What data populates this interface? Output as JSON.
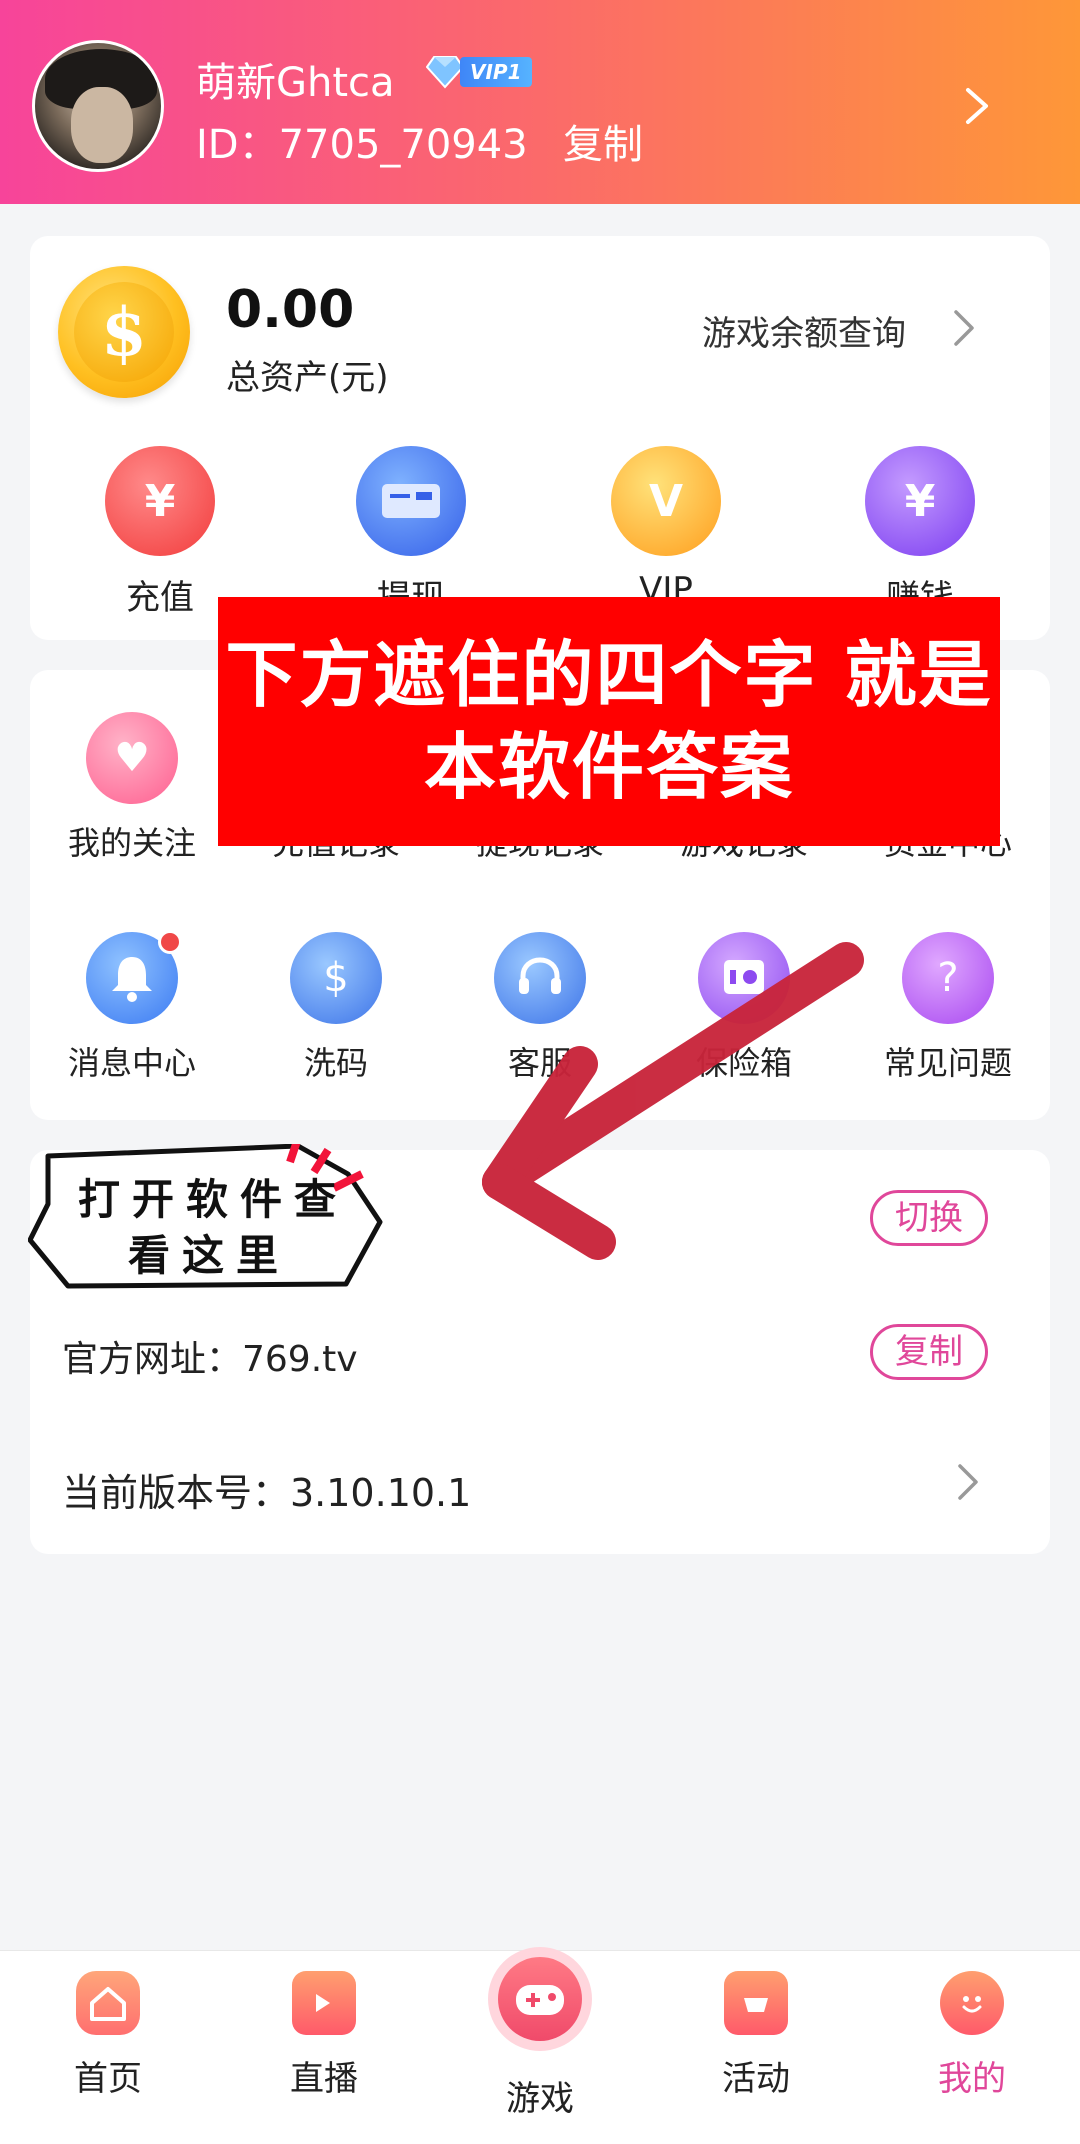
{
  "header": {
    "username": "萌新Ghtca",
    "vip_label": "VIP1",
    "user_id": "ID：7705_70943",
    "copy_label": "复制"
  },
  "assets": {
    "balance": "0.00",
    "balance_label": "总资产(元)",
    "game_balance_label": "游戏余额查询",
    "quick_actions": [
      {
        "label": "充值",
        "icon": "money-bag-icon"
      },
      {
        "label": "提现",
        "icon": "card-icon"
      },
      {
        "label": "VIP",
        "icon": "vip-diamond-icon"
      },
      {
        "label": "赚钱",
        "icon": "earn-bag-icon"
      }
    ]
  },
  "menu": {
    "row1": [
      {
        "label": "我的关注",
        "icon": "heart-plus-icon"
      },
      {
        "label": "充值记录",
        "icon": "record-icon"
      },
      {
        "label": "提现记录",
        "icon": "withdraw-record-icon"
      },
      {
        "label": "游戏记录",
        "icon": "game-record-icon"
      },
      {
        "label": "资金中心",
        "icon": "fund-center-icon"
      }
    ],
    "row2": [
      {
        "label": "消息中心",
        "icon": "bell-icon"
      },
      {
        "label": "洗码",
        "icon": "chip-icon"
      },
      {
        "label": "客服",
        "icon": "headset-icon"
      },
      {
        "label": "保险箱",
        "icon": "safe-icon"
      },
      {
        "label": "常见问题",
        "icon": "question-icon"
      }
    ]
  },
  "overlay": {
    "line1": "下方遮住的四个字 就是",
    "line2": "本软件答案"
  },
  "sticker": {
    "line1": "打开软件查",
    "line2": "看这里"
  },
  "info": {
    "switch_label": "切换",
    "official_url": "官方网址：769.tv",
    "copy_label": "复制",
    "version": "当前版本号：3.10.10.1"
  },
  "nav": [
    {
      "label": "首页",
      "icon": "home-icon"
    },
    {
      "label": "直播",
      "icon": "live-icon"
    },
    {
      "label": "游戏",
      "icon": "gamepad-icon"
    },
    {
      "label": "活动",
      "icon": "activity-icon"
    },
    {
      "label": "我的",
      "icon": "smile-icon",
      "active": true
    }
  ],
  "colors": {
    "header_gradient_start": "#f7449a",
    "header_gradient_end": "#fe9738",
    "accent_pink": "#e0479a",
    "overlay_red": "#ff0000",
    "arrow_red": "#c8243a"
  }
}
